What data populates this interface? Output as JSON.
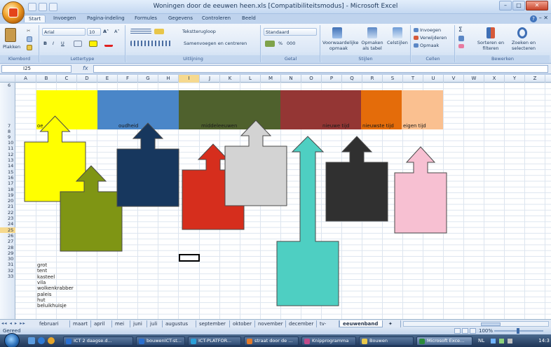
{
  "window": {
    "title": "Woningen door de eeuwen heen.xls  [Compatibiliteitsmodus] - Microsoft Excel",
    "minimize": "–",
    "maximize": "□",
    "close": "✕"
  },
  "ribbon_tabs": [
    "Start",
    "Invoegen",
    "Pagina-indeling",
    "Formules",
    "Gegevens",
    "Controleren",
    "Beeld"
  ],
  "ribbon": {
    "clipboard": {
      "paste": "Plakken",
      "label": "Klembord"
    },
    "font": {
      "name": "Arial",
      "size": "10",
      "bold": "B",
      "italic": "I",
      "underline": "U",
      "grow": "A˄",
      "shrink": "A˅",
      "label": "Lettertype"
    },
    "alignment": {
      "wrap": "Tekstterugloop",
      "merge": "Samenvoegen en centreren",
      "label": "Uitlijning"
    },
    "number": {
      "format": "Standaard",
      "label": "Getal",
      "percent": "%",
      "thousands": "000"
    },
    "styles": {
      "conditional": "Voorwaardelijke opmaak",
      "table": "Opmaken als tabel",
      "cell": "Celstijlen",
      "label": "Stijlen"
    },
    "cells": {
      "insert": "Invoegen",
      "delete": "Verwijderen",
      "format": "Opmaak",
      "label": "Cellen"
    },
    "editing": {
      "sigma": "Σ",
      "sort": "Sorteren en filteren",
      "find": "Zoeken en selecteren",
      "label": "Bewerken"
    }
  },
  "formula_bar": {
    "name_box": "I25",
    "fx": "fx",
    "value": ""
  },
  "columns": [
    "A",
    "B",
    "C",
    "D",
    "E",
    "F",
    "G",
    "H",
    "I",
    "J",
    "K",
    "L",
    "M",
    "N",
    "O",
    "P",
    "Q",
    "R",
    "S",
    "T",
    "U",
    "V",
    "W",
    "X",
    "Y",
    "Z"
  ],
  "selected_column": "I",
  "rows": [
    "6",
    "7",
    "8",
    "9",
    "10",
    "11",
    "12",
    "13",
    "14",
    "15",
    "16",
    "17",
    "18",
    "19",
    "20",
    "21",
    "22",
    "23",
    "24",
    "25",
    "26",
    "27",
    "28",
    "29",
    "30",
    "31",
    "32",
    "33"
  ],
  "selected_row": "25",
  "bands": [
    {
      "label": "oe",
      "color": "#ffff00"
    },
    {
      "label": "oudheid",
      "color": "#4a86c8"
    },
    {
      "label": "middeleeuwen",
      "color": "#4f612d"
    },
    {
      "label": "nieuwe tijd",
      "color": "#943634"
    },
    {
      "label": "nieuwste tijd",
      "color": "#e46c0a"
    },
    {
      "label": "eigen tijd",
      "color": "#fac090"
    }
  ],
  "arrow_colors": [
    "#ffff00",
    "#7f9514",
    "#17375e",
    "#d62e1d",
    "#d3d3d3",
    "#4ecfc2",
    "#303030",
    "#f7c0d2"
  ],
  "cell_list": [
    "grot",
    "tent",
    "kasteel",
    "vila",
    "wolkenkrabber",
    "paleis",
    "hut",
    "beluikhuisje"
  ],
  "sheet_nav": "◂◂ ◂ ▸ ▸▸",
  "sheets": [
    "februari",
    "maart",
    "april",
    "mei",
    "juni",
    "juli",
    "augustus",
    "september",
    "oktober",
    "november",
    "december",
    "tv-gids",
    "eeuwenband"
  ],
  "active_sheet": "eeuwenband",
  "status": {
    "text": "Gereed",
    "zoom": "100%"
  },
  "taskbar": {
    "items": [
      "ICT 2 daagse.d...",
      "bouwenICT-st...",
      "ICT-PLATFOR...",
      "straat door de ...",
      "Knipprogramma",
      "Bouwen",
      "Microsoft Exce..."
    ],
    "active_index": 6,
    "tray_lang": "NL",
    "clock": "14:3"
  }
}
